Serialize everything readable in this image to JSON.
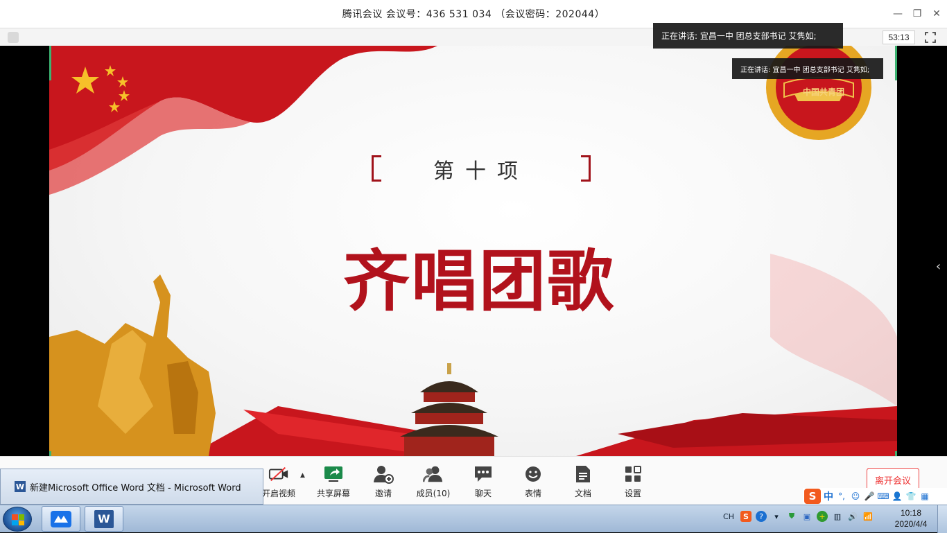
{
  "titlebar": {
    "title": "腾讯会议 会议号：436 531 034 （会议密码：202044）",
    "minimize_icon": "—",
    "restore_icon": "❐",
    "close_icon": "✕"
  },
  "subbar": {
    "timer": "53:13"
  },
  "toasts": {
    "speaking_primary": "正在讲话: 宜昌一中 团总支部书记 艾隽如;",
    "speaking_secondary": "正在讲话: 宜昌一中 团总支部书记 艾隽如;"
  },
  "slide": {
    "subtitle": "第十项",
    "title": "齐唱团歌",
    "badge_text": "中国共青团",
    "colors": {
      "red": "#b1121c",
      "gold": "#e6a623"
    }
  },
  "toolbar": {
    "video_label": "开启视频",
    "share_label": "共享屏幕",
    "invite_label": "邀请",
    "members_label": "成员(10)",
    "chat_label": "聊天",
    "emoji_label": "表情",
    "docs_label": "文档",
    "settings_label": "设置",
    "leave_label": "离开会议"
  },
  "preview": {
    "text": "新建Microsoft Office Word 文档 - Microsoft Word",
    "icon_letter": "W"
  },
  "ime": {
    "logo": "S",
    "mode": "中"
  },
  "taskbar": {
    "lang": "CH",
    "time": "10:18",
    "date": "2020/4/4",
    "word_icon_letter": "W"
  }
}
